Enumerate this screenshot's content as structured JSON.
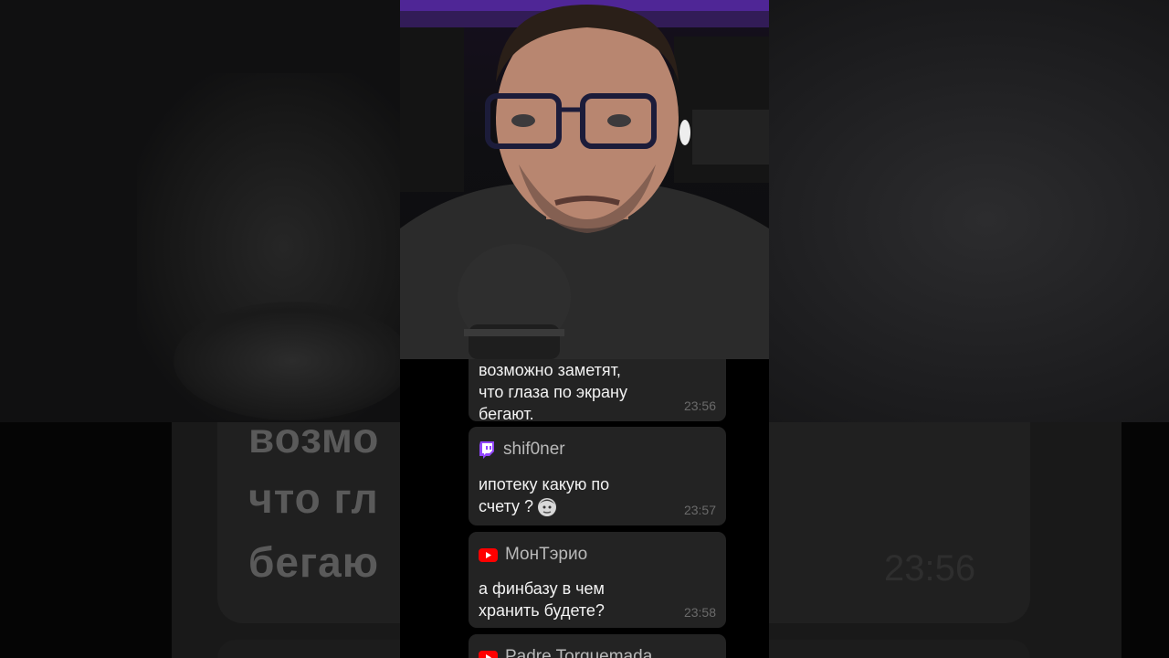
{
  "background": {
    "echo_text_lines": [
      "возмо",
      "что гл",
      "бегаю"
    ],
    "echo_time": "23:56"
  },
  "chat": {
    "messages": [
      {
        "platform": "unknown",
        "author": "",
        "lines": [
          "возможно заметят,",
          "что глаза по экрану",
          "бегают."
        ],
        "time": "23:56"
      },
      {
        "platform": "twitch",
        "icon": "twitch-icon",
        "author": "shif0ner",
        "lines": [
          "ипотеку какую по",
          "счету ?"
        ],
        "emote": "face-emote",
        "time": "23:57"
      },
      {
        "platform": "youtube",
        "icon": "youtube-icon",
        "author": "МонТэрио",
        "lines": [
          "а финбазу в чем",
          "хранить будете?"
        ],
        "time": "23:58"
      },
      {
        "platform": "youtube",
        "icon": "youtube-icon",
        "author": "Padre Torquemada",
        "lines": [],
        "time": ""
      }
    ]
  },
  "colors": {
    "twitch": "#9146ff",
    "youtube": "#ff0000",
    "card": "#232323",
    "accent_purple": "#5b2bb0"
  }
}
